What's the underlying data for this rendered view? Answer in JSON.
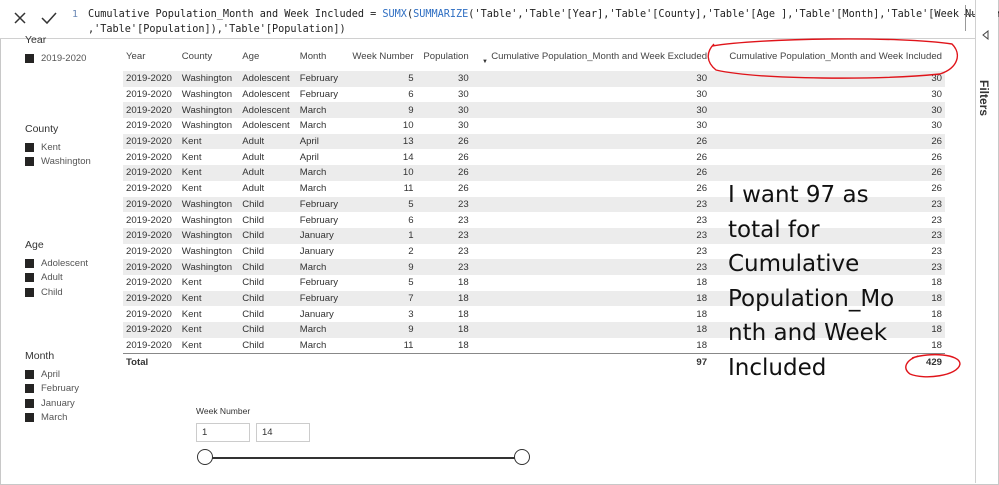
{
  "formula": {
    "line_number": "1",
    "line1_pre": "Cumulative Population_Month and Week Included = ",
    "line1_fn1": "SUMX",
    "line1_paren": "(",
    "line1_fn2": "SUMMARIZE",
    "line1_rest": "('Table','Table'[Year],'Table'[County],'Table'[Age ],'Table'[Month],'Table'[Week Number]",
    "line2": ",'Table'[Population]),'Table'[Population])"
  },
  "filters_pane": {
    "label": "Filters"
  },
  "slicers": {
    "year": {
      "title": "Year",
      "items": [
        "2019-2020"
      ]
    },
    "county": {
      "title": "County",
      "items": [
        "Kent",
        "Washington"
      ]
    },
    "age": {
      "title": "Age",
      "items": [
        "Adolescent",
        "Adult",
        "Child"
      ]
    },
    "month": {
      "title": "Month",
      "items": [
        "April",
        "February",
        "January",
        "March"
      ]
    }
  },
  "table": {
    "headers": [
      "Year",
      "County",
      "Age",
      "Month",
      "Week Number",
      "Population",
      "Cumulative Population_Month and Week Excluded",
      "Cumulative Population_Month and Week Included"
    ],
    "rows": [
      [
        "2019-2020",
        "Washington",
        "Adolescent",
        "February",
        "5",
        "30",
        "30",
        "30"
      ],
      [
        "2019-2020",
        "Washington",
        "Adolescent",
        "February",
        "6",
        "30",
        "30",
        "30"
      ],
      [
        "2019-2020",
        "Washington",
        "Adolescent",
        "March",
        "9",
        "30",
        "30",
        "30"
      ],
      [
        "2019-2020",
        "Washington",
        "Adolescent",
        "March",
        "10",
        "30",
        "30",
        "30"
      ],
      [
        "2019-2020",
        "Kent",
        "Adult",
        "April",
        "13",
        "26",
        "26",
        "26"
      ],
      [
        "2019-2020",
        "Kent",
        "Adult",
        "April",
        "14",
        "26",
        "26",
        "26"
      ],
      [
        "2019-2020",
        "Kent",
        "Adult",
        "March",
        "10",
        "26",
        "26",
        "26"
      ],
      [
        "2019-2020",
        "Kent",
        "Adult",
        "March",
        "11",
        "26",
        "26",
        "26"
      ],
      [
        "2019-2020",
        "Washington",
        "Child",
        "February",
        "5",
        "23",
        "23",
        "23"
      ],
      [
        "2019-2020",
        "Washington",
        "Child",
        "February",
        "6",
        "23",
        "23",
        "23"
      ],
      [
        "2019-2020",
        "Washington",
        "Child",
        "January",
        "1",
        "23",
        "23",
        "23"
      ],
      [
        "2019-2020",
        "Washington",
        "Child",
        "January",
        "2",
        "23",
        "23",
        "23"
      ],
      [
        "2019-2020",
        "Washington",
        "Child",
        "March",
        "9",
        "23",
        "23",
        "23"
      ],
      [
        "2019-2020",
        "Kent",
        "Child",
        "February",
        "5",
        "18",
        "18",
        "18"
      ],
      [
        "2019-2020",
        "Kent",
        "Child",
        "February",
        "7",
        "18",
        "18",
        "18"
      ],
      [
        "2019-2020",
        "Kent",
        "Child",
        "January",
        "3",
        "18",
        "18",
        "18"
      ],
      [
        "2019-2020",
        "Kent",
        "Child",
        "March",
        "9",
        "18",
        "18",
        "18"
      ],
      [
        "2019-2020",
        "Kent",
        "Child",
        "March",
        "11",
        "18",
        "18",
        "18"
      ]
    ],
    "total": {
      "label": "Total",
      "excluded": "97",
      "included": "429"
    }
  },
  "annotation": {
    "lines": [
      "I want 97 as",
      "total for",
      "Cumulative",
      "Population_Mo",
      "nth and Week",
      "Included"
    ],
    "circle_color": "#e0141a"
  },
  "week_slicer": {
    "title": "Week Number",
    "min_value": "1",
    "max_value": "14"
  },
  "icons": {
    "cancel": "close-icon",
    "commit": "check-icon",
    "filters": "chevron-icon"
  }
}
